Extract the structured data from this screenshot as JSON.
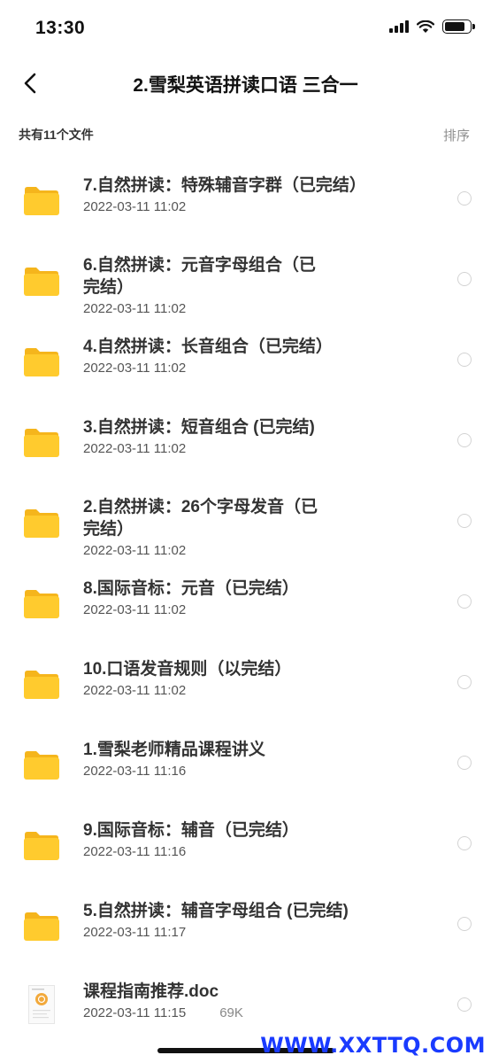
{
  "status": {
    "time": "13:30"
  },
  "header": {
    "title": "2.雪梨英语拼读口语 三合一"
  },
  "subheader": {
    "count": "共有11个文件",
    "sort_label": "排序"
  },
  "files": [
    {
      "name": "7.自然拼读：特殊辅音字群（已完结）",
      "date": "2022-03-11 11:02",
      "type": "folder"
    },
    {
      "name": "6.自然拼读：元音字母组合（已\n完结）",
      "date": "2022-03-11 11:02",
      "type": "folder"
    },
    {
      "name": "4.自然拼读：长音组合（已完结）",
      "date": "2022-03-11 11:02",
      "type": "folder"
    },
    {
      "name": "3.自然拼读：短音组合 (已完结)",
      "date": "2022-03-11 11:02",
      "type": "folder"
    },
    {
      "name": "2.自然拼读：26个字母发音（已\n完结）",
      "date": "2022-03-11 11:02",
      "type": "folder"
    },
    {
      "name": "8.国际音标：元音（已完结）",
      "date": "2022-03-11 11:02",
      "type": "folder"
    },
    {
      "name": "10.口语发音规则（以完结）",
      "date": "2022-03-11 11:02",
      "type": "folder"
    },
    {
      "name": "1.雪梨老师精品课程讲义",
      "date": "2022-03-11 11:16",
      "type": "folder"
    },
    {
      "name": "9.国际音标：辅音（已完结）",
      "date": "2022-03-11 11:16",
      "type": "folder"
    },
    {
      "name": "5.自然拼读：辅音字母组合 (已完结)",
      "date": "2022-03-11 11:17",
      "type": "folder"
    },
    {
      "name": "课程指南推荐.doc",
      "date": "2022-03-11 11:15",
      "size": "69K",
      "type": "doc"
    }
  ],
  "watermark": "WWW.XXTTQ.COM",
  "colors": {
    "folder": "#FFCB2E",
    "folder_tab": "#F5B51C",
    "radio_border": "#D3D3D3",
    "watermark": "#1A3BFF"
  }
}
